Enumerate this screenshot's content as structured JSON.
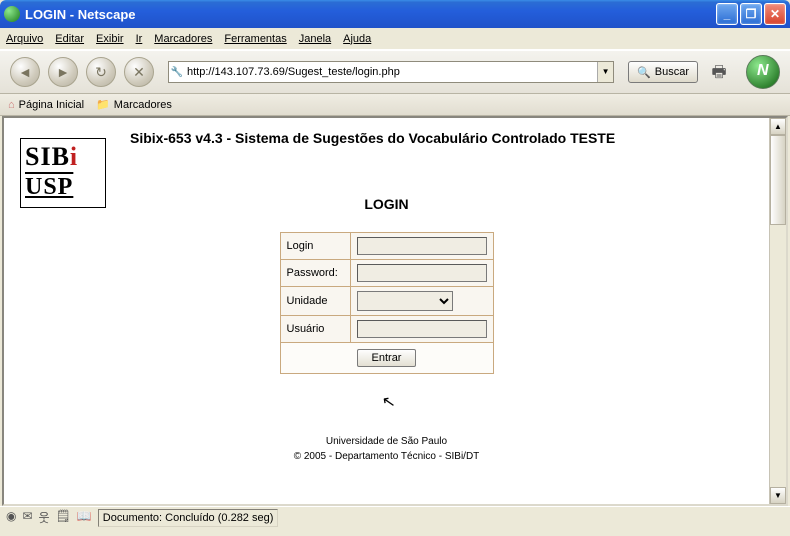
{
  "window": {
    "title": "LOGIN - Netscape"
  },
  "menu": {
    "arquivo": "Arquivo",
    "editar": "Editar",
    "exibir": "Exibir",
    "ir": "Ir",
    "marcadores": "Marcadores",
    "ferramentas": "Ferramentas",
    "janela": "Janela",
    "ajuda": "Ajuda"
  },
  "toolbar": {
    "url": "http://143.107.73.69/Sugest_teste/login.php",
    "search_label": "Buscar"
  },
  "bookmarks": {
    "home": "Página Inicial",
    "marks": "Marcadores"
  },
  "page": {
    "title": "Sibix-653 v4.3 - Sistema de Sugestões do Vocabulário Controlado TESTE",
    "logo_line1a": "SIB",
    "logo_line1b": "i",
    "logo_line2": "USP",
    "login_heading": "LOGIN",
    "labels": {
      "login": "Login",
      "password": "Password:",
      "unidade": "Unidade",
      "usuario": "Usuário"
    },
    "values": {
      "login": "",
      "password": "",
      "unidade": "",
      "usuario": ""
    },
    "submit": "Entrar",
    "footer1": "Universidade de São Paulo",
    "footer2": "© 2005 - Departamento Técnico - SIBi/DT"
  },
  "status": {
    "doc": "Documento: Concluído (0.282 seg)"
  }
}
